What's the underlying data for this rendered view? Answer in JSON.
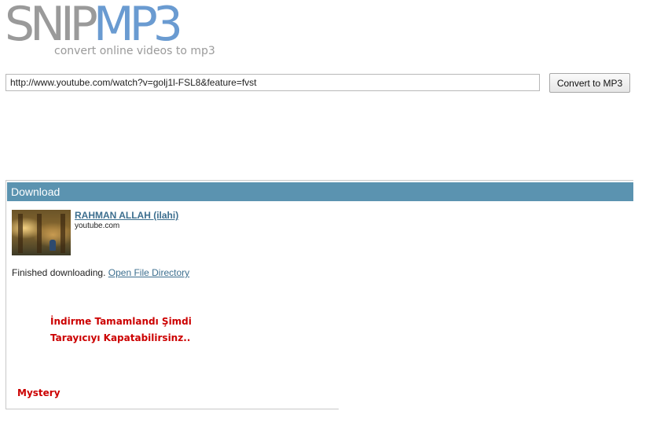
{
  "logo": {
    "snip": "SNIP",
    "mp3": "MP3",
    "tagline": "convert online videos to mp3"
  },
  "url_bar": {
    "value": "http://www.youtube.com/watch?v=golj1l-FSL8&feature=fvst",
    "convert_label": "Convert to MP3"
  },
  "download": {
    "header": "Download",
    "video_title": "RAHMAN ALLAH (ilahi)",
    "video_source": "youtube.com",
    "status_text": "Finished downloading.",
    "open_dir_label": "Open File Directory"
  },
  "annotations": {
    "line1": "İndirme Tamamlandı Şimdi",
    "line2": "Tarayıcıyı Kapatabilirsinz..",
    "signature": "Mystery"
  },
  "colors": {
    "logo_gray": "#9a9a9a",
    "logo_blue": "#6a9bd1",
    "header_bg": "#5b93b0",
    "link": "#3d6f8f",
    "annotation_red": "#cc0000"
  }
}
